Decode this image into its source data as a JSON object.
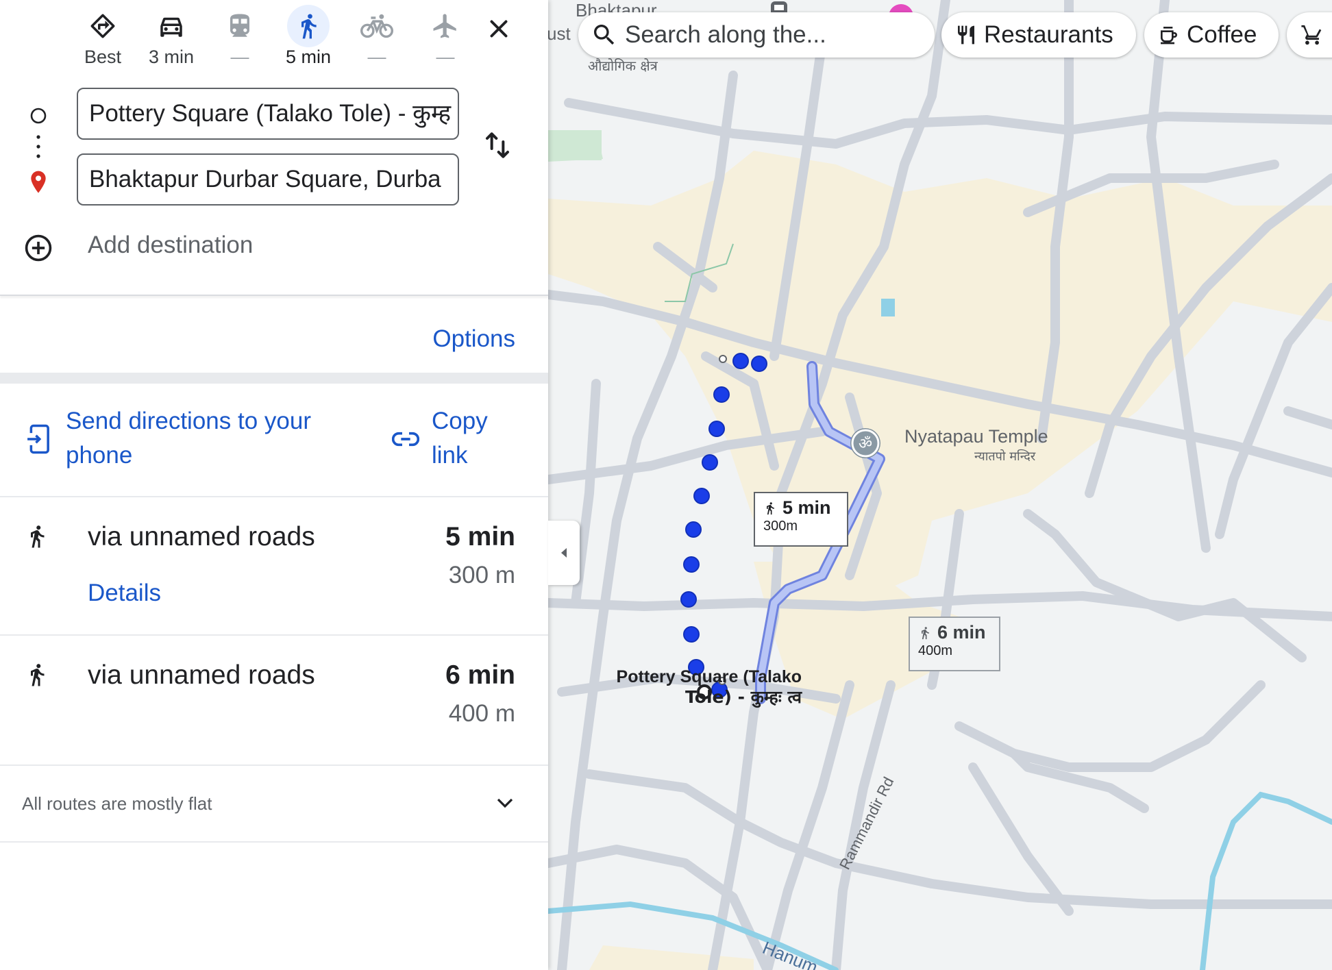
{
  "travel_modes": [
    {
      "name": "best",
      "label": "Best"
    },
    {
      "name": "driving",
      "label": "3 min"
    },
    {
      "name": "transit",
      "label": "—"
    },
    {
      "name": "walking",
      "label": "5 min",
      "selected": true
    },
    {
      "name": "cycling",
      "label": "—"
    },
    {
      "name": "flights",
      "label": "—"
    }
  ],
  "origin": {
    "value": "Pottery Square (Talako Tole) - कुम्ह"
  },
  "destination": {
    "value": "Bhaktapur Durbar Square, Durba"
  },
  "add_destination_label": "Add destination",
  "options_label": "Options",
  "send_directions_label": "Send directions to your phone",
  "copy_link_label": "Copy link",
  "routes": [
    {
      "title": "via unnamed roads",
      "time": "5 min",
      "distance": "300 m",
      "details_label": "Details"
    },
    {
      "title": "via unnamed roads",
      "time": "6 min",
      "distance": "400 m"
    }
  ],
  "elevation_note": "All routes are mostly flat",
  "map": {
    "search_placeholder": "Search along the...",
    "chips": [
      "Restaurants",
      "Coffee"
    ],
    "labels": {
      "top_place": "Bhaktapur",
      "top_partial": "ust",
      "industrial_area": "औद्योगिक क्षेत्र",
      "temple_name": "Nyatapau Temple",
      "temple_name_local": "न्यातपो मन्दिर",
      "road_name": "Rammandir Rd",
      "river_name": "Hanum",
      "origin_label_line1": "Pottery Square (Talako",
      "origin_label_line2": "Tole) - कुम्हः त्व"
    },
    "route_callouts": [
      {
        "time": "5 min",
        "distance": "300m"
      },
      {
        "time": "6 min",
        "distance": "400m"
      }
    ]
  },
  "colors": {
    "accent": "#1a57c9",
    "route_dots": "#1a3ee8",
    "alt_route": "#a8b8f0"
  }
}
